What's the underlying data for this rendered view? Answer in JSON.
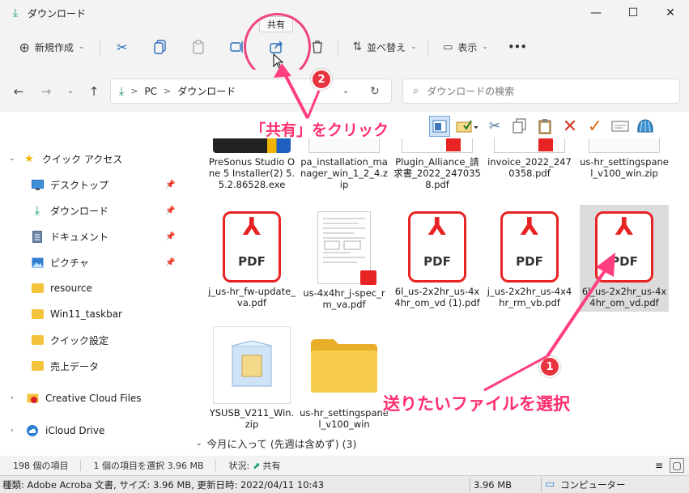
{
  "window": {
    "title": "ダウンロード",
    "minimize": "—",
    "maximize": "☐",
    "close": "✕"
  },
  "toolbar": {
    "new_label": "新規作成",
    "sort_label": "並べ替え",
    "view_label": "表示",
    "more": "•••",
    "share_tooltip": "共有"
  },
  "address": {
    "crumb_pc": "PC",
    "crumb_folder": "ダウンロード",
    "separator": ">",
    "search_placeholder": "ダウンロードの検索"
  },
  "annotations": {
    "click_share": "「共有」をクリック",
    "select_file": "送りたいファイルを選択",
    "badge1": "1",
    "badge2": "2"
  },
  "sidebar": {
    "quick_access": "クイック アクセス",
    "items": [
      {
        "label": "デスクトップ",
        "icon": "desktop-icon",
        "pinned": true
      },
      {
        "label": "ダウンロード",
        "icon": "download-icon",
        "pinned": true
      },
      {
        "label": "ドキュメント",
        "icon": "document-icon",
        "pinned": true
      },
      {
        "label": "ピクチャ",
        "icon": "picture-icon",
        "pinned": true
      },
      {
        "label": "resource",
        "icon": "folder-icon",
        "pinned": false
      },
      {
        "label": "Win11_taskbar",
        "icon": "folder-icon",
        "pinned": false
      },
      {
        "label": "クイック設定",
        "icon": "folder-icon",
        "pinned": false
      },
      {
        "label": "売上データ",
        "icon": "folder-icon",
        "pinned": false
      }
    ],
    "creative_cloud": "Creative Cloud Files",
    "icloud": "iCloud Drive"
  },
  "files_row0": [
    "PreSonus Studio One 5 Installer(2) 5.5.2.86528.exe",
    "pa_installation_manager_win_1_2_4.zip",
    "Plugin_Alliance_請求書_2022_2470358.pdf",
    "invoice_2022_2470358.pdf",
    "us-hr_settingspanel_v100_win.zip"
  ],
  "files_row1": [
    "j_us-hr_fw-update_va.pdf",
    "us-4x4hr_j-spec_rm_va.pdf",
    "6l_us-2x2hr_us-4x4hr_om_vd (1).pdf",
    "j_us-2x2hr_us-4x4hr_rm_vb.pdf",
    "6l_us-2x2hr_us-4x4hr_om_vd.pdf"
  ],
  "files_row2": [
    "YSUSB_V211_Win.zip",
    "us-hr_settingspanel_v100_win"
  ],
  "pdf_label": "PDF",
  "group_header": "今月に入って (先週は含めず) (3)",
  "status": {
    "count": "198 個の項目",
    "selected": "1 個の項目を選択  3.96 MB",
    "state_label": "状況:",
    "state_value": "共有"
  },
  "bottom": {
    "info": "種類: Adobe Acroba 文書, サイズ: 3.96 MB, 更新日時: 2022/04/11 10:43",
    "size": "3.96 MB",
    "location": "コンピューター"
  }
}
